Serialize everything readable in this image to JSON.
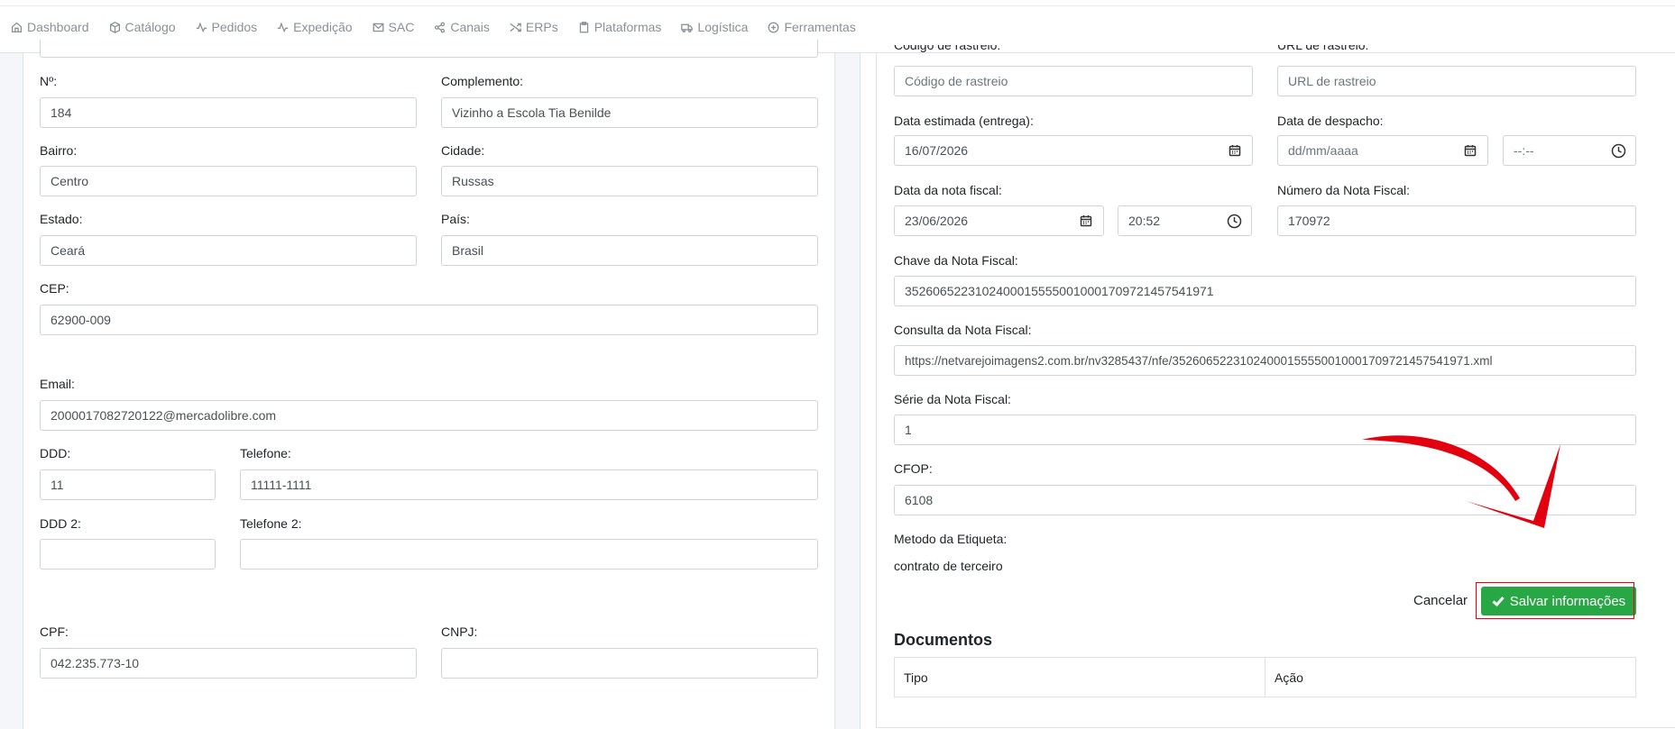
{
  "nav": {
    "items": [
      {
        "label": "Dashboard",
        "icon": "home-icon"
      },
      {
        "label": "Catálogo",
        "icon": "box-icon"
      },
      {
        "label": "Pedidos",
        "icon": "activity-icon"
      },
      {
        "label": "Expedição",
        "icon": "activity-icon"
      },
      {
        "label": "SAC",
        "icon": "mail-icon"
      },
      {
        "label": "Canais",
        "icon": "share-icon"
      },
      {
        "label": "ERPs",
        "icon": "shuffle-icon"
      },
      {
        "label": "Plataformas",
        "icon": "clipboard-icon"
      },
      {
        "label": "Logística",
        "icon": "truck-icon"
      },
      {
        "label": "Ferramentas",
        "icon": "plus-circle-icon"
      }
    ]
  },
  "address": {
    "numero_label": "Nº:",
    "numero_value": "184",
    "complemento_label": "Complemento:",
    "complemento_value": "Vizinho a Escola Tia Benilde",
    "bairro_label": "Bairro:",
    "bairro_value": "Centro",
    "cidade_label": "Cidade:",
    "cidade_value": "Russas",
    "estado_label": "Estado:",
    "estado_value": "Ceará",
    "pais_label": "País:",
    "pais_value": "Brasil",
    "cep_label": "CEP:",
    "cep_value": "62900-009"
  },
  "contact": {
    "email_label": "Email:",
    "email_value": "2000017082720122@mercadolibre.com",
    "ddd_label": "DDD:",
    "ddd_value": "11",
    "telefone_label": "Telefone:",
    "telefone_value": "11111-1111",
    "ddd2_label": "DDD 2:",
    "ddd2_value": "",
    "telefone2_label": "Telefone 2:",
    "telefone2_value": "",
    "cpf_label": "CPF:",
    "cpf_value": "042.235.773-10",
    "cnpj_label": "CNPJ:",
    "cnpj_value": ""
  },
  "shipping": {
    "rastreio_label": "Código de rastreio:",
    "rastreio_placeholder": "Código de rastreio",
    "url_label": "URL de rastreio:",
    "url_placeholder": "URL de rastreio",
    "data_estimada_label": "Data estimada (entrega):",
    "data_estimada_value": "16/07/2026",
    "data_despacho_label": "Data de despacho:",
    "data_despacho_placeholder": "dd/mm/aaaa",
    "hora_despacho_placeholder": "--:--",
    "data_nf_label": "Data da nota fiscal:",
    "data_nf_value": "23/06/2026",
    "hora_nf_value": "20:52",
    "numero_nf_label": "Número da Nota Fiscal:",
    "numero_nf_value": "170972",
    "chave_nf_label": "Chave da Nota Fiscal:",
    "chave_nf_value": "35260652231024000155550010001709721457541971",
    "consulta_nf_label": "Consulta da Nota Fiscal:",
    "consulta_nf_value": "https://netvarejoimagens2.com.br/nv3285437/nfe/35260652231024000155550010001709721457541971.xml",
    "serie_nf_label": "Série da Nota Fiscal:",
    "serie_nf_value": "1",
    "cfop_label": "CFOP:",
    "cfop_value": "6108",
    "metodo_label": "Metodo da Etiqueta:",
    "metodo_value": "contrato de terceiro"
  },
  "actions": {
    "cancel_label": "Cancelar",
    "save_label": "Salvar informações"
  },
  "documents": {
    "title": "Documentos",
    "columns": [
      "Tipo",
      "Ação"
    ]
  },
  "colors": {
    "accent_green": "#28a745",
    "annotation_red": "#e3000f"
  }
}
